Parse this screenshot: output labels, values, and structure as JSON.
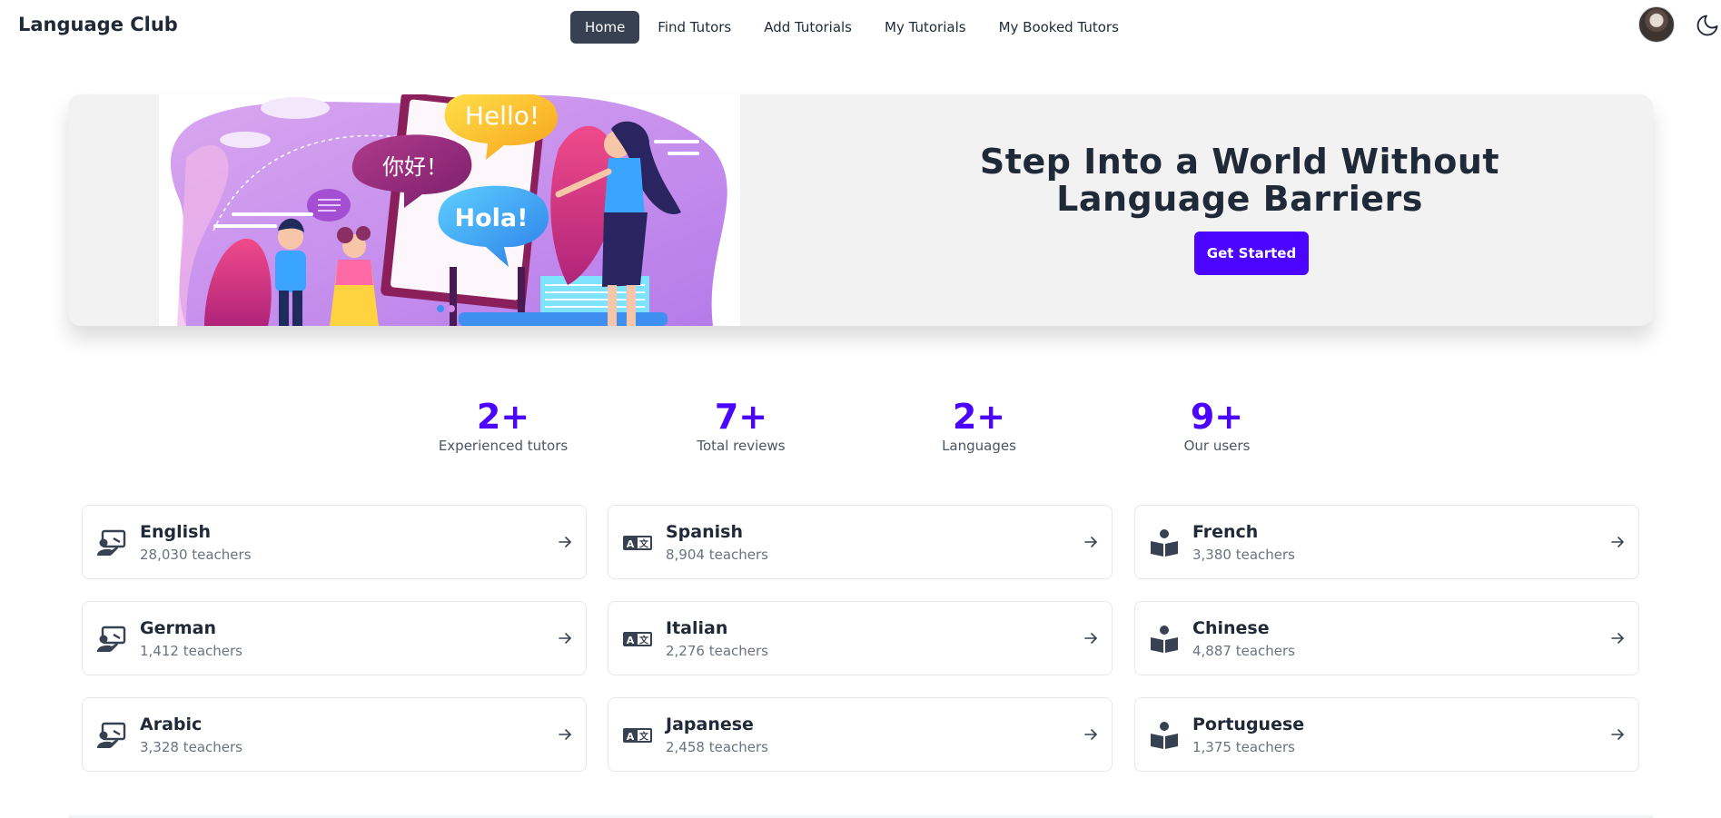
{
  "navbar": {
    "brand": "Language Club",
    "links": [
      {
        "label": "Home",
        "active": true
      },
      {
        "label": "Find Tutors",
        "active": false
      },
      {
        "label": "Add Tutorials",
        "active": false
      },
      {
        "label": "My Tutorials",
        "active": false
      },
      {
        "label": "My Booked Tutors",
        "active": false
      }
    ],
    "theme_icon": "moon-icon"
  },
  "hero": {
    "title": "Step Into a World Without Language Barriers",
    "button": "Get Started",
    "illustration": {
      "bubble_1": "Hello!",
      "bubble_2": "你好！",
      "bubble_3": "Hola!"
    }
  },
  "stats": [
    {
      "value": "2+",
      "label": "Experienced tutors"
    },
    {
      "value": "7+",
      "label": "Total reviews"
    },
    {
      "value": "2+",
      "label": "Languages"
    },
    {
      "value": "9+",
      "label": "Our users"
    }
  ],
  "languages": [
    {
      "name": "English",
      "count": "28,030 teachers",
      "icon": "teacher-board-icon"
    },
    {
      "name": "Spanish",
      "count": "8,904 teachers",
      "icon": "translate-icon"
    },
    {
      "name": "French",
      "count": "3,380 teachers",
      "icon": "reader-book-icon"
    },
    {
      "name": "German",
      "count": "1,412 teachers",
      "icon": "teacher-board-icon"
    },
    {
      "name": "Italian",
      "count": "2,276 teachers",
      "icon": "translate-icon"
    },
    {
      "name": "Chinese",
      "count": "4,887 teachers",
      "icon": "reader-book-icon"
    },
    {
      "name": "Arabic",
      "count": "3,328 teachers",
      "icon": "teacher-board-icon"
    },
    {
      "name": "Japanese",
      "count": "2,458 teachers",
      "icon": "translate-icon"
    },
    {
      "name": "Portuguese",
      "count": "1,375 teachers",
      "icon": "reader-book-icon"
    }
  ],
  "colors": {
    "accent": "#4a04ff",
    "nav_active": "#374151",
    "text": "#1f2937",
    "muted": "#6b7280"
  }
}
